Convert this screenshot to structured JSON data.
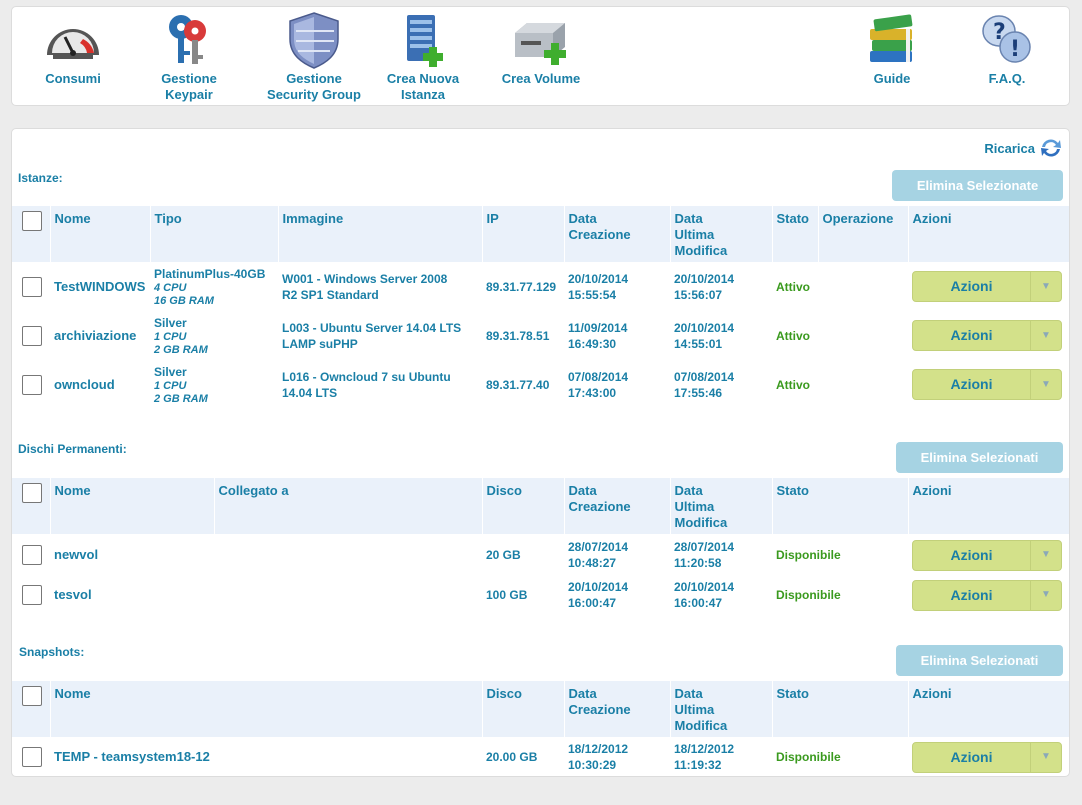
{
  "toolbar": {
    "consumi": "Consumi",
    "keypair_l1": "Gestione",
    "keypair_l2": "Keypair",
    "secgroup_l1": "Gestione",
    "secgroup_l2": "Security Group",
    "nuova_l1": "Crea Nuova",
    "nuova_l2": "Istanza",
    "volume": "Crea Volume",
    "guide": "Guide",
    "faq": "F.A.Q."
  },
  "reload_label": "Ricarica",
  "instances": {
    "title": "Istanze:",
    "delete_label": "Elimina Selezionate",
    "headers": {
      "nome": "Nome",
      "tipo": "Tipo",
      "immagine": "Immagine",
      "ip": "IP",
      "creazione_l1": "Data",
      "creazione_l2": "Creazione",
      "modifica_l1": "Data",
      "modifica_l2": "Ultima",
      "modifica_l3": "Modifica",
      "stato": "Stato",
      "operazione": "Operazione",
      "azioni": "Azioni"
    },
    "rows": [
      {
        "nome": "TestWINDOWS",
        "tipo": "PlatinumPlus-40GB",
        "cpu": "4 CPU",
        "ram": "16 GB RAM",
        "img_l1": "W001 - Windows Server 2008",
        "img_l2": "R2 SP1 Standard",
        "ip": "89.31.77.129",
        "cr_d": "20/10/2014",
        "cr_t": "15:55:54",
        "md_d": "20/10/2014",
        "md_t": "15:56:07",
        "stato": "Attivo",
        "azioni": "Azioni"
      },
      {
        "nome": "archiviazione",
        "tipo": "Silver",
        "cpu": "1 CPU",
        "ram": "2 GB RAM",
        "img_l1": "L003 - Ubuntu Server 14.04 LTS",
        "img_l2": "LAMP suPHP",
        "ip": "89.31.78.51",
        "cr_d": "11/09/2014",
        "cr_t": "16:49:30",
        "md_d": "20/10/2014",
        "md_t": "14:55:01",
        "stato": "Attivo",
        "azioni": "Azioni"
      },
      {
        "nome": "owncloud",
        "tipo": "Silver",
        "cpu": "1 CPU",
        "ram": "2 GB RAM",
        "img_l1": "L016 - Owncloud 7 su Ubuntu",
        "img_l2": "14.04 LTS",
        "ip": "89.31.77.40",
        "cr_d": "07/08/2014",
        "cr_t": "17:43:00",
        "md_d": "07/08/2014",
        "md_t": "17:55:46",
        "stato": "Attivo",
        "azioni": "Azioni"
      }
    ]
  },
  "disks": {
    "title": "Dischi Permanenti:",
    "delete_label": "Elimina Selezionati",
    "headers": {
      "nome": "Nome",
      "collegato": "Collegato a",
      "disco": "Disco",
      "creazione_l1": "Data",
      "creazione_l2": "Creazione",
      "modifica_l1": "Data",
      "modifica_l2": "Ultima",
      "modifica_l3": "Modifica",
      "stato": "Stato",
      "azioni": "Azioni"
    },
    "rows": [
      {
        "nome": "newvol",
        "collegato": "",
        "disco": "20 GB",
        "cr_d": "28/07/2014",
        "cr_t": "10:48:27",
        "md_d": "28/07/2014",
        "md_t": "11:20:58",
        "stato": "Disponibile",
        "azioni": "Azioni"
      },
      {
        "nome": "tesvol",
        "collegato": "",
        "disco": "100 GB",
        "cr_d": "20/10/2014",
        "cr_t": "16:00:47",
        "md_d": "20/10/2014",
        "md_t": "16:00:47",
        "stato": "Disponibile",
        "azioni": "Azioni"
      }
    ]
  },
  "snapshots": {
    "title": "Snapshots:",
    "delete_label": "Elimina Selezionati",
    "headers": {
      "nome": "Nome",
      "disco": "Disco",
      "creazione_l1": "Data",
      "creazione_l2": "Creazione",
      "modifica_l1": "Data",
      "modifica_l2": "Ultima",
      "modifica_l3": "Modifica",
      "stato": "Stato",
      "azioni": "Azioni"
    },
    "rows": [
      {
        "nome": "TEMP - teamsystem18-12",
        "disco": "20.00 GB",
        "cr_d": "18/12/2012",
        "cr_t": "10:30:29",
        "md_d": "18/12/2012",
        "md_t": "11:19:32",
        "stato": "Disponibile",
        "azioni": "Azioni"
      }
    ]
  },
  "colors": {
    "link": "#1a7fa6",
    "status_green": "#3a9a1e",
    "action_button": "#d3e18a",
    "delete_button": "#a6d3e3",
    "header_bg": "#eaf1fa"
  }
}
